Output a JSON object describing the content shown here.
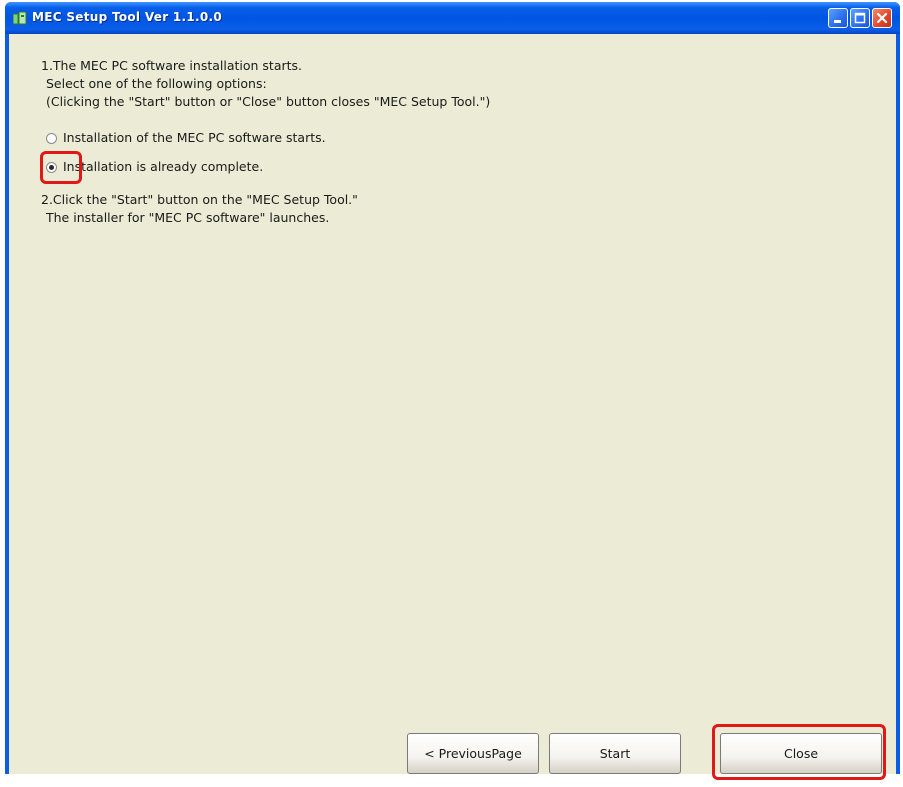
{
  "window": {
    "title": "MEC Setup Tool  Ver 1.1.0.0",
    "titlebar_color": "#0054e3",
    "client_color": "#ecebd6",
    "highlight_color": "#e01818"
  },
  "instructions": {
    "step1_line1": "1.The MEC PC software installation starts.",
    "step1_line2": "Select one of the following options:",
    "step1_line3": "(Clicking the \"Start\" button or \"Close\" button closes \"MEC Setup Tool.\")",
    "step2_line1": "2.Click the \"Start\" button on the \"MEC Setup Tool.\"",
    "step2_line2": "The installer for \"MEC PC software\" launches."
  },
  "options": [
    {
      "label": "Installation of the MEC PC software starts.",
      "selected": false
    },
    {
      "label": "Installation is already complete.",
      "selected": true
    }
  ],
  "buttons": {
    "previous": "< PreviousPage",
    "start": "Start",
    "close": "Close"
  }
}
